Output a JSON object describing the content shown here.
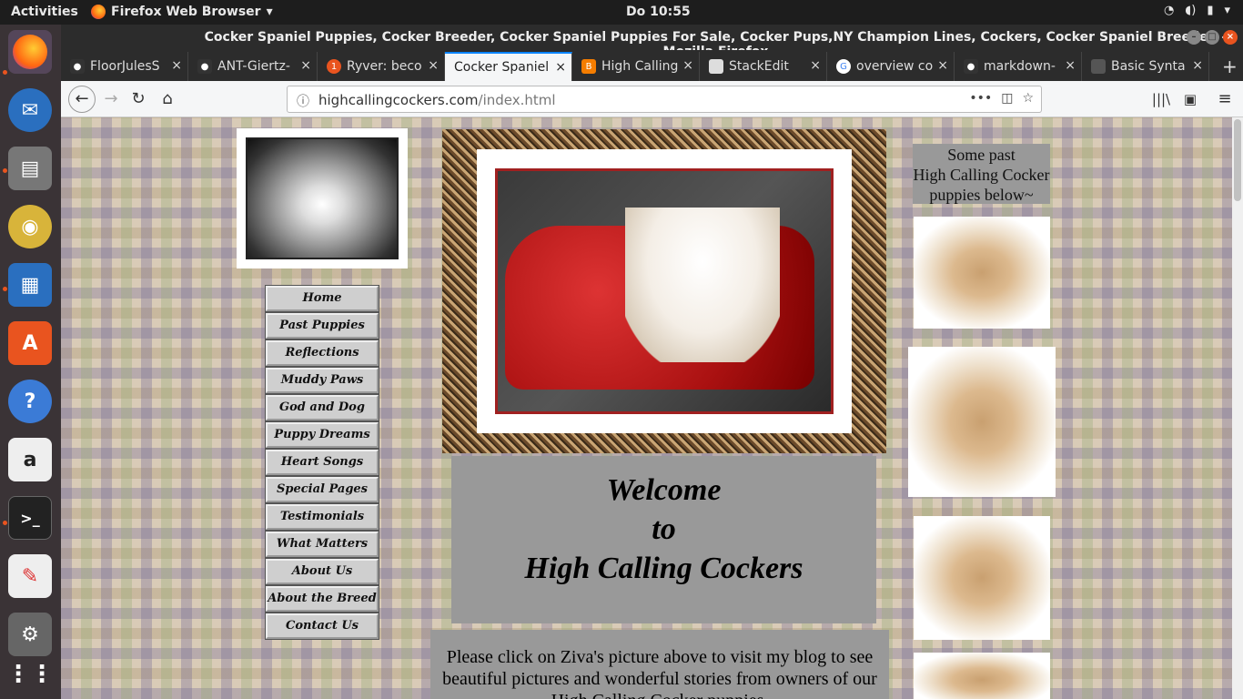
{
  "system": {
    "activities": "Activities",
    "app_name": "Firefox Web Browser",
    "clock": "Do 10:55"
  },
  "window": {
    "title": "Cocker Spaniel Puppies, Cocker Breeder, Cocker Spaniel Puppies For Sale, Cocker Pups,NY Champion Lines, Cockers, Cocker Spaniel Breeder, - Mozilla Firefox"
  },
  "tabs": [
    {
      "label": "FloorJulesS",
      "icon": "github-icon",
      "active": false
    },
    {
      "label": "ANT-Giertz-",
      "icon": "github-icon",
      "active": false
    },
    {
      "label": "Ryver: beco",
      "icon": "notification-icon",
      "badge": "1",
      "active": false
    },
    {
      "label": "Cocker Spaniel",
      "icon": "",
      "active": true
    },
    {
      "label": "High Calling",
      "icon": "blogger-icon",
      "active": false
    },
    {
      "label": "StackEdit",
      "icon": "stackedit-icon",
      "active": false
    },
    {
      "label": "overview co",
      "icon": "google-icon",
      "active": false
    },
    {
      "label": "markdown-",
      "icon": "github-icon",
      "active": false
    },
    {
      "label": "Basic Synta",
      "icon": "doc-icon",
      "active": false
    }
  ],
  "url": {
    "domain": "highcallingcockers.com",
    "path": "/index.html"
  },
  "site": {
    "menu": [
      "Home",
      "Past Puppies",
      "Reflections",
      "Muddy Paws",
      "God and Dog",
      "Puppy Dreams",
      "Heart Songs",
      "Special Pages",
      "Testimonials",
      "What Matters",
      "About Us",
      "About the Breed",
      "Contact Us"
    ],
    "welcome_line1": "Welcome",
    "welcome_line2": "to",
    "welcome_line3": "High Calling Cockers",
    "blurb": "Please click on Ziva's picture above to visit my blog to see beautiful pictures and wonderful stories from owners of our High Calling Cocker puppies.",
    "past_line1": "Some past",
    "past_line2": "High Calling Cocker",
    "past_line3": "puppies below~"
  },
  "colors": {
    "ubuntu_orange": "#e9541f",
    "firefox_blue": "#0a84ff",
    "panel_gray": "#999999",
    "frame_red": "#a02020"
  }
}
